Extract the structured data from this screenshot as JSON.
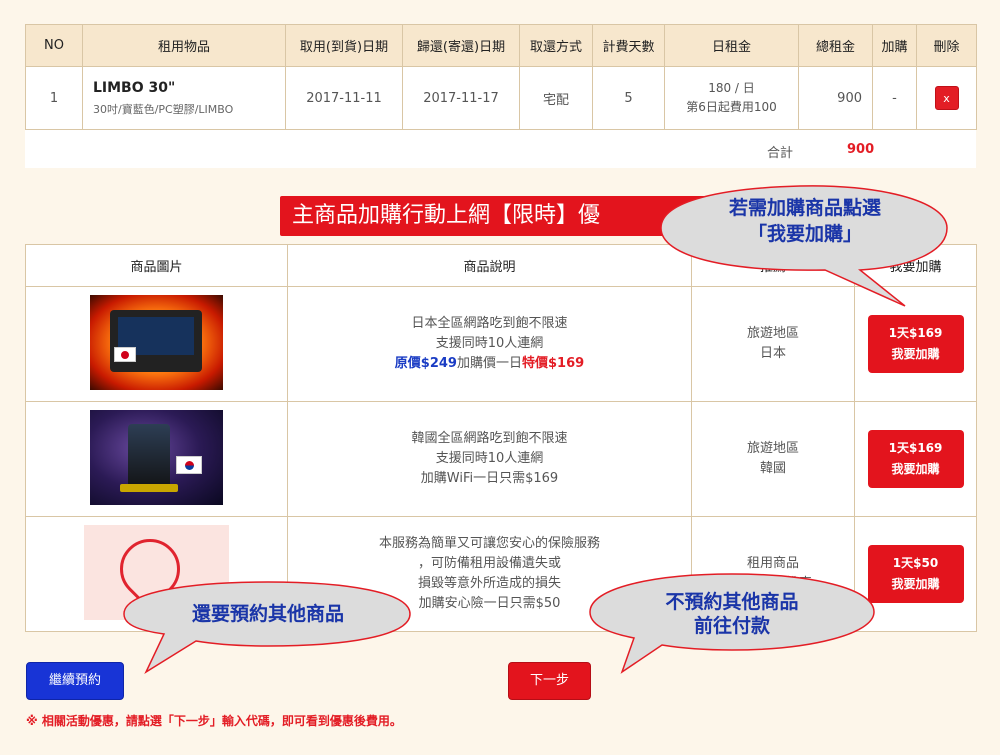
{
  "cart": {
    "headers": [
      "NO",
      "租用物品",
      "取用(到貨)日期",
      "歸還(寄還)日期",
      "取還方式",
      "計費天數",
      "日租金",
      "總租金",
      "加購",
      "刪除"
    ],
    "rows": [
      {
        "no": "1",
        "item_name": "LIMBO 30\"",
        "item_desc": "30吋/寶藍色/PC塑膠/LIMBO",
        "pickup_date": "2017-11-11",
        "return_date": "2017-11-17",
        "method": "宅配",
        "days": "5",
        "daily_rate_line1": "180 / 日",
        "daily_rate_line2": "第6日起費用100",
        "total": "900",
        "addon": "-",
        "delete_label": "x"
      }
    ],
    "sum_label": "合計",
    "sum_value": "900"
  },
  "banner": {
    "title": "主商品加購行動上網【限時】優"
  },
  "addon_table": {
    "headers": [
      "商品圖片",
      "商品說明",
      "推薦",
      "我要加購"
    ],
    "rows": [
      {
        "desc_line1": "日本全區網路吃到飽不限速",
        "desc_line2": "支援同時10人連網",
        "price_orig": "原價$249",
        "price_mid": "加購價一日",
        "price_special": "特價$169",
        "rec_line1": "旅遊地區",
        "rec_line2": "日本",
        "btn_line1": "1天$169",
        "btn_line2": "我要加購"
      },
      {
        "desc_line1": "韓國全區網路吃到飽不限速",
        "desc_line2": "支援同時10人連網",
        "desc_line3": "加購WiFi一日只需$169",
        "rec_line1": "旅遊地區",
        "rec_line2": "韓國",
        "btn_line1": "1天$169",
        "btn_line2": "我要加購"
      },
      {
        "desc_line1": "本服務為簡單又可讓您安心的保險服務",
        "desc_line2": "，可防備租用設備遺失或",
        "desc_line3": "損毀等意外所造成的損失",
        "desc_line4": "加購安心險一日只需$50",
        "rec_line1": "租用商品",
        "rec_line2": "行李箱、推車",
        "btn_line1": "1天$50",
        "btn_line2": "我要加購"
      }
    ]
  },
  "buttons": {
    "continue": "繼續預約",
    "next": "下一步"
  },
  "note": "※ 相關活動優惠，請點選「下一步」輸入代碼，即可看到優惠後費用。",
  "callouts": {
    "top_line1": "若需加購商品點選",
    "top_line2": "「我要加購」",
    "left": "還要預約其他商品",
    "right_line1": "不預約其他商品",
    "right_line2": "前往付款"
  }
}
